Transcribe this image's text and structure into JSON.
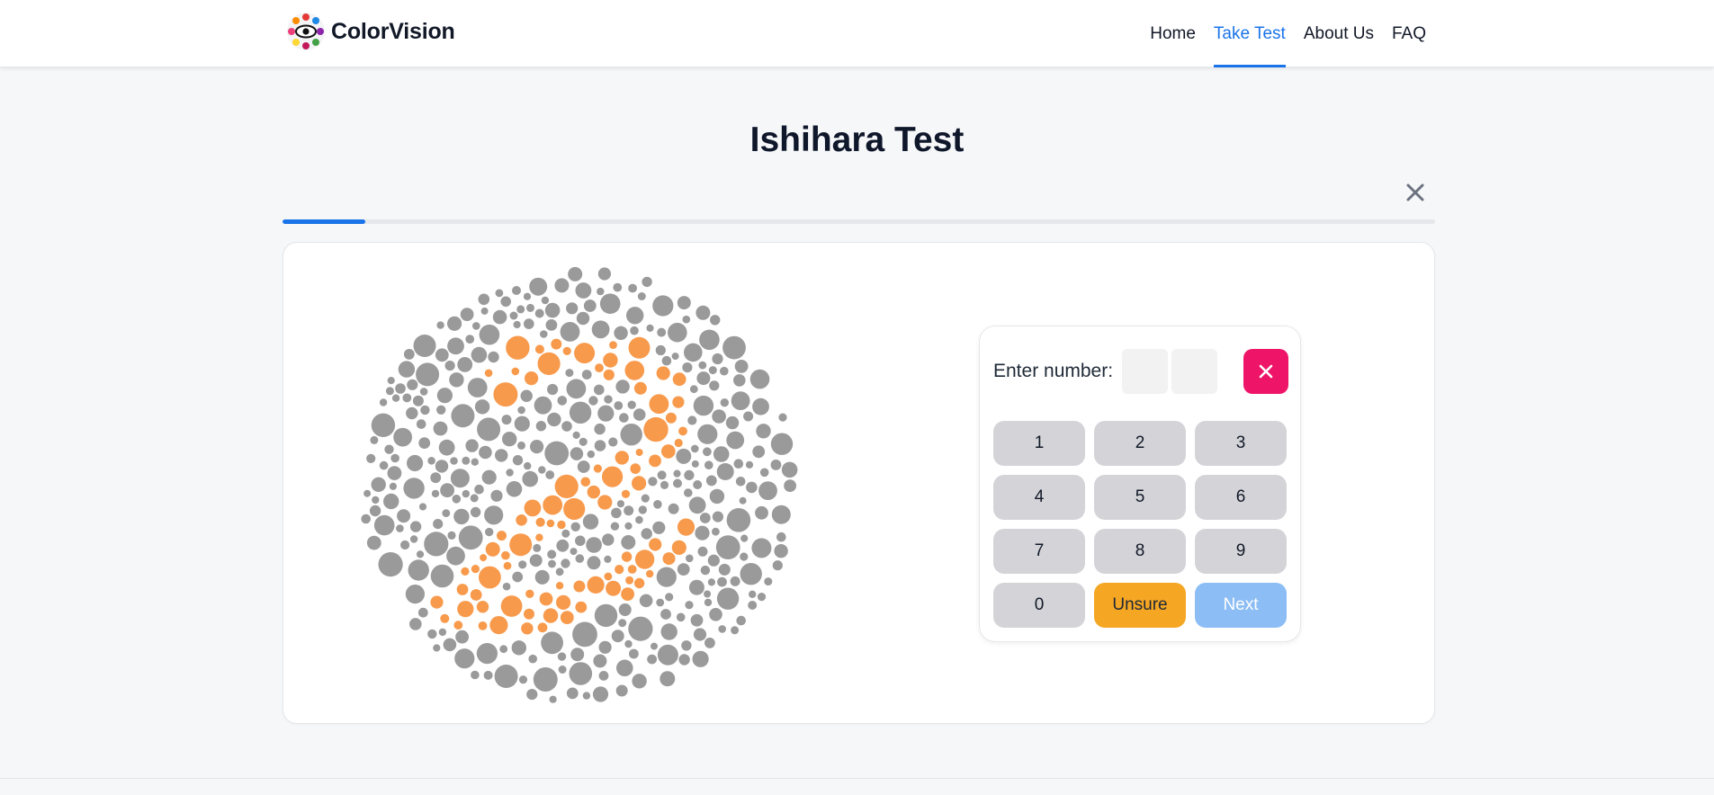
{
  "app": {
    "brand": "ColorVision",
    "logo_icon": "eye-color-wheel-icon"
  },
  "nav": {
    "items": [
      {
        "label": "Home",
        "active": false
      },
      {
        "label": "Take Test",
        "active": true
      },
      {
        "label": "About Us",
        "active": false
      },
      {
        "label": "FAQ",
        "active": false
      }
    ]
  },
  "page": {
    "title": "Ishihara Test",
    "close_icon": "close-icon"
  },
  "progress": {
    "fraction": 0.072
  },
  "plate": {
    "icon": "ishihara-plate-image",
    "figure_color": "#f89a4c",
    "background_color": "#9a9a9a"
  },
  "keypad": {
    "label": "Enter number:",
    "digits": [
      "",
      ""
    ],
    "clear_icon": "close-icon",
    "keys": [
      "1",
      "2",
      "3",
      "4",
      "5",
      "6",
      "7",
      "8",
      "9",
      "0"
    ],
    "unsure_label": "Unsure",
    "next_label": "Next"
  },
  "colors": {
    "accent": "#1a73e8",
    "clear": "#ee1568",
    "unsure": "#f5a623",
    "next_disabled": "#8cbdf5",
    "key": "#d4d4d8"
  }
}
